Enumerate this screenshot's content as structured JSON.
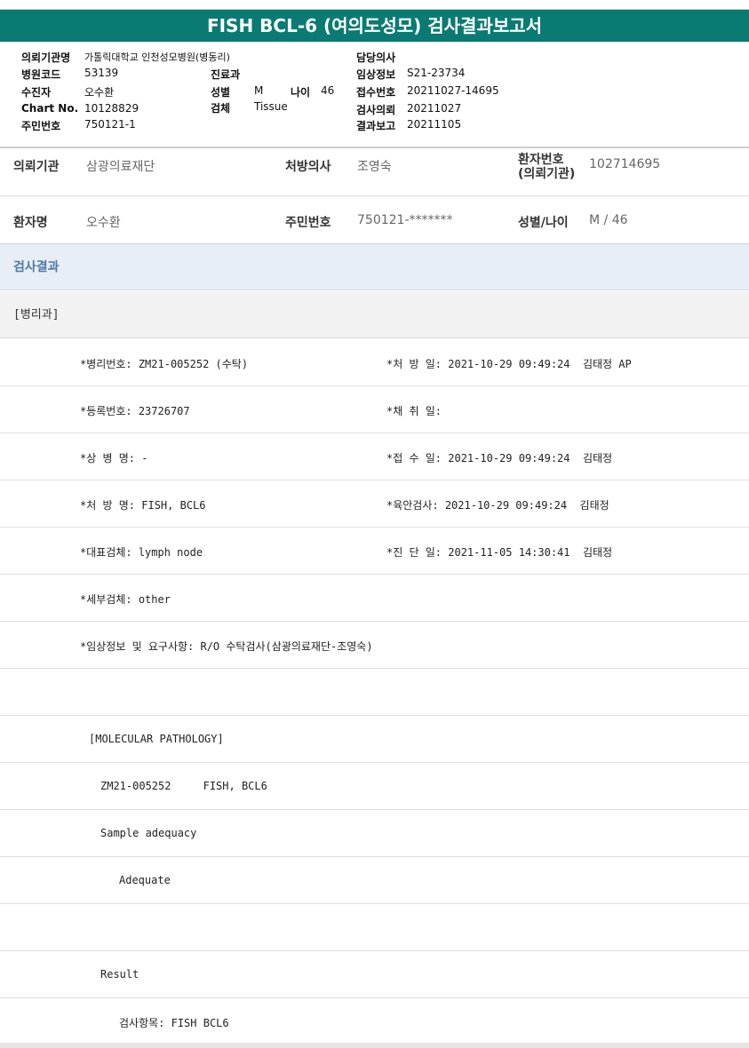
{
  "report_title": "FISH BCL-6 (여의도성모) 검사결과보고서",
  "header": {
    "institution_label": "의뢰기관명",
    "institution_value": "가톨릭대학교 인천성모병원(병동리)",
    "hospital_code_label": "병원코드",
    "hospital_code_value": "53139",
    "dept_label": "진료과",
    "dept_value": "",
    "patient_label": "수진자",
    "patient_value": "오수환",
    "sex_label": "성별",
    "sex_value": "M",
    "age_label": "나이",
    "age_value": "46",
    "chart_label": "Chart No.",
    "chart_value": "10128829",
    "specimen_label": "검체",
    "specimen_value": "Tissue",
    "id_label": "주민번호",
    "id_value": "750121-1",
    "doctor_label": "담당의사",
    "doctor_value": "",
    "clinical_label": "임상정보",
    "clinical_value": "S21-23734",
    "receipt_label": "접수번호",
    "receipt_value": "20211027-14695",
    "request_label": "검사의뢰",
    "request_value": "20211027",
    "report_label": "결과보고",
    "report_value": "20211105"
  },
  "patient_table": {
    "req_inst_label": "의뢰기관",
    "req_inst_value": "삼광의료재단",
    "prescriber_label": "처방의사",
    "prescriber_value": "조영숙",
    "patient_no_label_1": "환자번호",
    "patient_no_label_2": "(의뢰기관)",
    "patient_no_value": "102714695",
    "name_label": "환자명",
    "name_value": "오수환",
    "rrn_label": "주민번호",
    "rrn_value": "750121-*******",
    "sexage_label": "성별/나이",
    "sexage_value": "M / 46"
  },
  "section_result": "검사결과",
  "section_path": "[병리과]",
  "rows": [
    {
      "left": "*병리번호: ZM21-005252 (수탁)",
      "right": "*처 방 일: 2021-10-29 09:49:24  김태정 AP"
    },
    {
      "left": "*등록번호: 23726707",
      "right": "*채 취 일:"
    },
    {
      "left": "*상 병 명: -",
      "right": "*접 수 일: 2021-10-29 09:49:24  김태정"
    },
    {
      "left": "*처 방 명: FISH, BCL6",
      "right": "*육안검사: 2021-10-29 09:49:24  김태정"
    },
    {
      "left": "*대표검체: lymph node",
      "right": "*진 단 일: 2021-11-05 14:30:41  김태정"
    },
    {
      "left": "*세부검체: other",
      "right": ""
    },
    {
      "left": "*임상정보 및 요구사항: R/O 수탁검사(삼광의료재단-조영숙)",
      "right": ""
    }
  ],
  "body_lines": {
    "molecular": "[MOLECULAR PATHOLOGY]",
    "case_line": "ZM21-005252     FISH, BCL6",
    "adequacy_label": "Sample adequacy",
    "adequacy_value": "Adequate",
    "result_label": "Result",
    "test_item": "검사항목: FISH BCL6"
  }
}
